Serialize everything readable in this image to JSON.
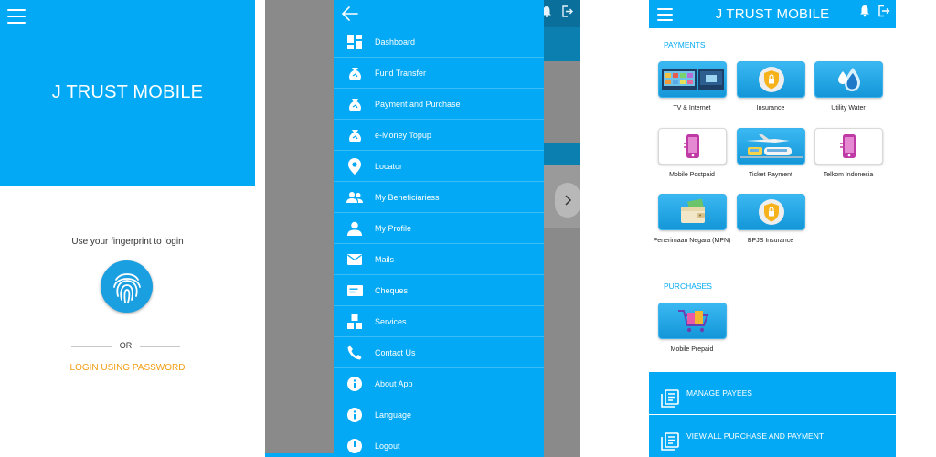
{
  "login_screen": {
    "app_title": "J TRUST MOBILE",
    "fingerprint_prompt": "Use your fingerprint to login",
    "or_text": "OR",
    "password_login_link": "LOGIN USING PASSWORD"
  },
  "drawer_screen": {
    "menu_items": [
      {
        "label": "Dashboard",
        "icon": "dashboard-icon"
      },
      {
        "label": "Fund Transfer",
        "icon": "money-bag-icon"
      },
      {
        "label": "Payment and Purchase",
        "icon": "money-bag-icon"
      },
      {
        "label": "e-Money Topup",
        "icon": "money-bag-icon"
      },
      {
        "label": "Locator",
        "icon": "location-pin-icon"
      },
      {
        "label": "My Beneficiariess",
        "icon": "people-icon"
      },
      {
        "label": "My Profile",
        "icon": "person-icon"
      },
      {
        "label": "Mails",
        "icon": "mail-icon"
      },
      {
        "label": "Cheques",
        "icon": "cheque-icon"
      },
      {
        "label": "Services",
        "icon": "services-icon"
      },
      {
        "label": "Contact Us",
        "icon": "phone-icon"
      },
      {
        "label": "About App",
        "icon": "info-icon"
      },
      {
        "label": "Language",
        "icon": "info-icon"
      },
      {
        "label": "Logout",
        "icon": "logout-icon"
      }
    ]
  },
  "payments_screen": {
    "app_title": "J TRUST MOBILE",
    "payments_section": "PAYMENTS",
    "purchases_section": "PURCHASES",
    "payment_tiles": [
      {
        "label": "TV & Internet",
        "icon": "tv-icon"
      },
      {
        "label": "Insurance",
        "icon": "insurance-shield-icon"
      },
      {
        "label": "Utility Water",
        "icon": "water-drop-icon"
      },
      {
        "label": "Mobile Postpaid",
        "icon": "mobile-phone-icon"
      },
      {
        "label": "Ticket Payment",
        "icon": "transport-icon"
      },
      {
        "label": "Telkom Indonesia",
        "icon": "mobile-phone-icon"
      },
      {
        "label": "Penerimaan Negara (MPN)",
        "icon": "wallet-icon"
      },
      {
        "label": "BPJS Insurance",
        "icon": "insurance-shield-icon"
      }
    ],
    "purchase_tiles": [
      {
        "label": "Mobile Prepaid",
        "icon": "shopping-cart-icon"
      }
    ],
    "manage_payees": "MANAGE PAYEES",
    "view_all": "VIEW ALL PURCHASE AND PAYMENT"
  },
  "colors": {
    "primary": "#03a9f4",
    "accent_link": "#f39c12",
    "overlay": "#8a8a8a"
  }
}
